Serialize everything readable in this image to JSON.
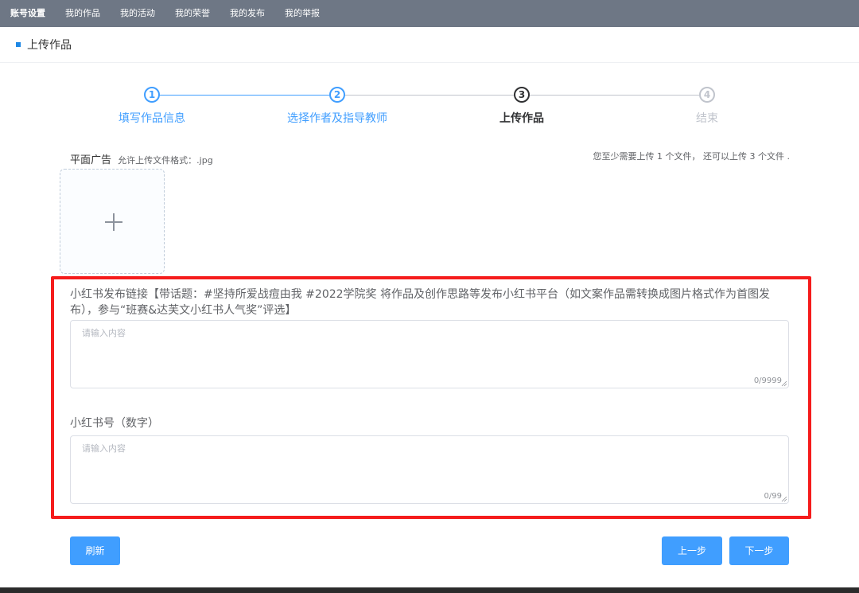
{
  "nav": {
    "items": [
      {
        "label": "账号设置"
      },
      {
        "label": "我的作品"
      },
      {
        "label": "我的活动"
      },
      {
        "label": "我的荣誉"
      },
      {
        "label": "我的发布"
      },
      {
        "label": "我的举报"
      }
    ]
  },
  "header": {
    "title": "上传作品"
  },
  "steps": [
    {
      "number": "1",
      "label": "填写作品信息",
      "status": "done"
    },
    {
      "number": "2",
      "label": "选择作者及指导教师",
      "status": "done"
    },
    {
      "number": "3",
      "label": "上传作品",
      "status": "current"
    },
    {
      "number": "4",
      "label": "结束",
      "status": "wait"
    }
  ],
  "upload": {
    "label": "平面广告",
    "hint": "允许上传文件格式：.jpg",
    "count_text": "您至少需要上传 1 个文件， 还可以上传 3 个文件 ."
  },
  "link_field": {
    "label": "小红书发布链接【带话题：#坚持所爱战痘由我  #2022学院奖 将作品及创作思路等发布小红书平台（如文案作品需转换成图片格式作为首图发布），参与“班赛&达芙文小红书人气奖”评选】",
    "placeholder": "请输入内容",
    "counter": "0/9999"
  },
  "account_field": {
    "label": "小红书号（数字）",
    "placeholder": "请输入内容",
    "counter": "0/99"
  },
  "buttons": {
    "refresh": "刷新",
    "prev": "上一步",
    "next": "下一步"
  },
  "colors": {
    "primary": "#409eff",
    "highlight": "#f51c1c",
    "nav_bg": "#6e7785"
  }
}
